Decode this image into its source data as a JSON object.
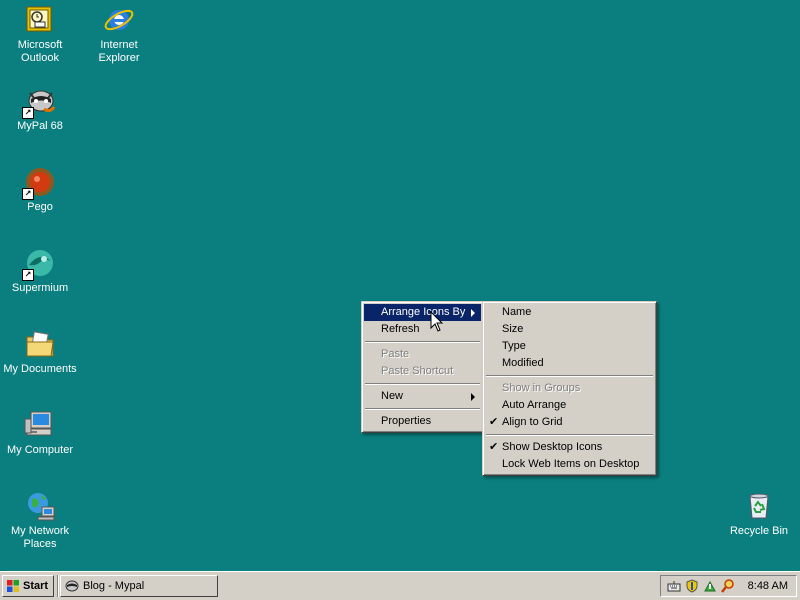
{
  "desktop": {
    "icons": [
      {
        "label": "Microsoft Outlook",
        "icon": "outlook-icon"
      },
      {
        "label": "Internet Explorer",
        "icon": "ie-icon"
      },
      {
        "label": "MyPal 68",
        "icon": "mypal-icon"
      },
      {
        "label": "Pego",
        "icon": "pego-icon"
      },
      {
        "label": "Supermium",
        "icon": "supermium-icon"
      },
      {
        "label": "My Documents",
        "icon": "folder-icon"
      },
      {
        "label": "My Computer",
        "icon": "computer-icon"
      },
      {
        "label": "My Network Places",
        "icon": "network-icon"
      },
      {
        "label": "Recycle Bin",
        "icon": "recycle-bin-icon"
      }
    ],
    "background_color": "#0b7f7f"
  },
  "context_menu": {
    "items": [
      {
        "label": "Arrange Icons By",
        "submenu": true,
        "selected": true
      },
      {
        "label": "Refresh"
      },
      {
        "label": "Paste",
        "disabled": true
      },
      {
        "label": "Paste Shortcut",
        "disabled": true
      },
      {
        "label": "New",
        "submenu": true
      },
      {
        "label": "Properties"
      }
    ]
  },
  "submenu": {
    "items": [
      {
        "label": "Name"
      },
      {
        "label": "Size"
      },
      {
        "label": "Type"
      },
      {
        "label": "Modified"
      },
      {
        "label": "Show in Groups",
        "disabled": true
      },
      {
        "label": "Auto Arrange"
      },
      {
        "label": "Align to Grid",
        "checked": true
      },
      {
        "label": "Show Desktop Icons",
        "checked": true
      },
      {
        "label": "Lock Web Items on Desktop"
      }
    ],
    "check_glyph": "✔"
  },
  "taskbar": {
    "start_label": "Start",
    "task_label": "Blog - Mypal",
    "clock": "8:48 AM",
    "selection_color": "#0a246a"
  }
}
